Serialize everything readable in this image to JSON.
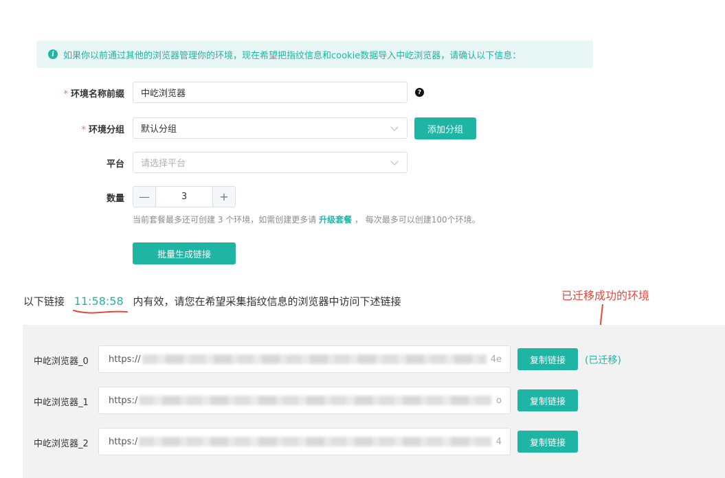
{
  "notice": {
    "text": "如果你以前通过其他的浏览器管理你的环境，现在希望把指纹信息和cookie数据导入中屹浏览器，请确认以下信息："
  },
  "form": {
    "name_prefix": {
      "required_mark": "*",
      "label": "环境名称前缀",
      "value": "中屹浏览器"
    },
    "group": {
      "required_mark": "*",
      "label": "环境分组",
      "value": "默认分组",
      "add_button": "添加分组"
    },
    "platform": {
      "label": "平台",
      "placeholder": "请选择平台"
    },
    "quantity": {
      "label": "数量",
      "minus": "—",
      "value": "3",
      "plus": "+"
    },
    "hint": {
      "before": "当前套餐最多还可创建 3 个环境，如需创建更多请",
      "link": "升级套餐",
      "after": "，  每次最多可以创建100个环境。"
    },
    "generate_button": "批量生成链接"
  },
  "links_section": {
    "before": "以下链接",
    "timer": "11:58:58",
    "after": "内有效，请您在希望采集指纹信息的浏览器中访问下述链接",
    "annotation": "已迁移成功的环境",
    "rows": [
      {
        "label": "中屹浏览器_0",
        "url_prefix": "https://",
        "url_suffix": "4e",
        "copy": "复制链接",
        "status": "(已迁移)"
      },
      {
        "label": "中屹浏览器_1",
        "url_prefix": "https:/",
        "url_suffix": "o",
        "copy": "复制链接",
        "status": ""
      },
      {
        "label": "中屹浏览器_2",
        "url_prefix": "https:/",
        "url_suffix": "4",
        "copy": "复制链接",
        "status": ""
      }
    ]
  },
  "colors": {
    "accent": "#1fb5a4",
    "annotation": "#e8473b",
    "required": "#f56c6c"
  },
  "icons": [
    "info-icon",
    "help-icon",
    "chevron-down-icon",
    "minus-icon",
    "plus-icon",
    "arrow-down-icon"
  ]
}
